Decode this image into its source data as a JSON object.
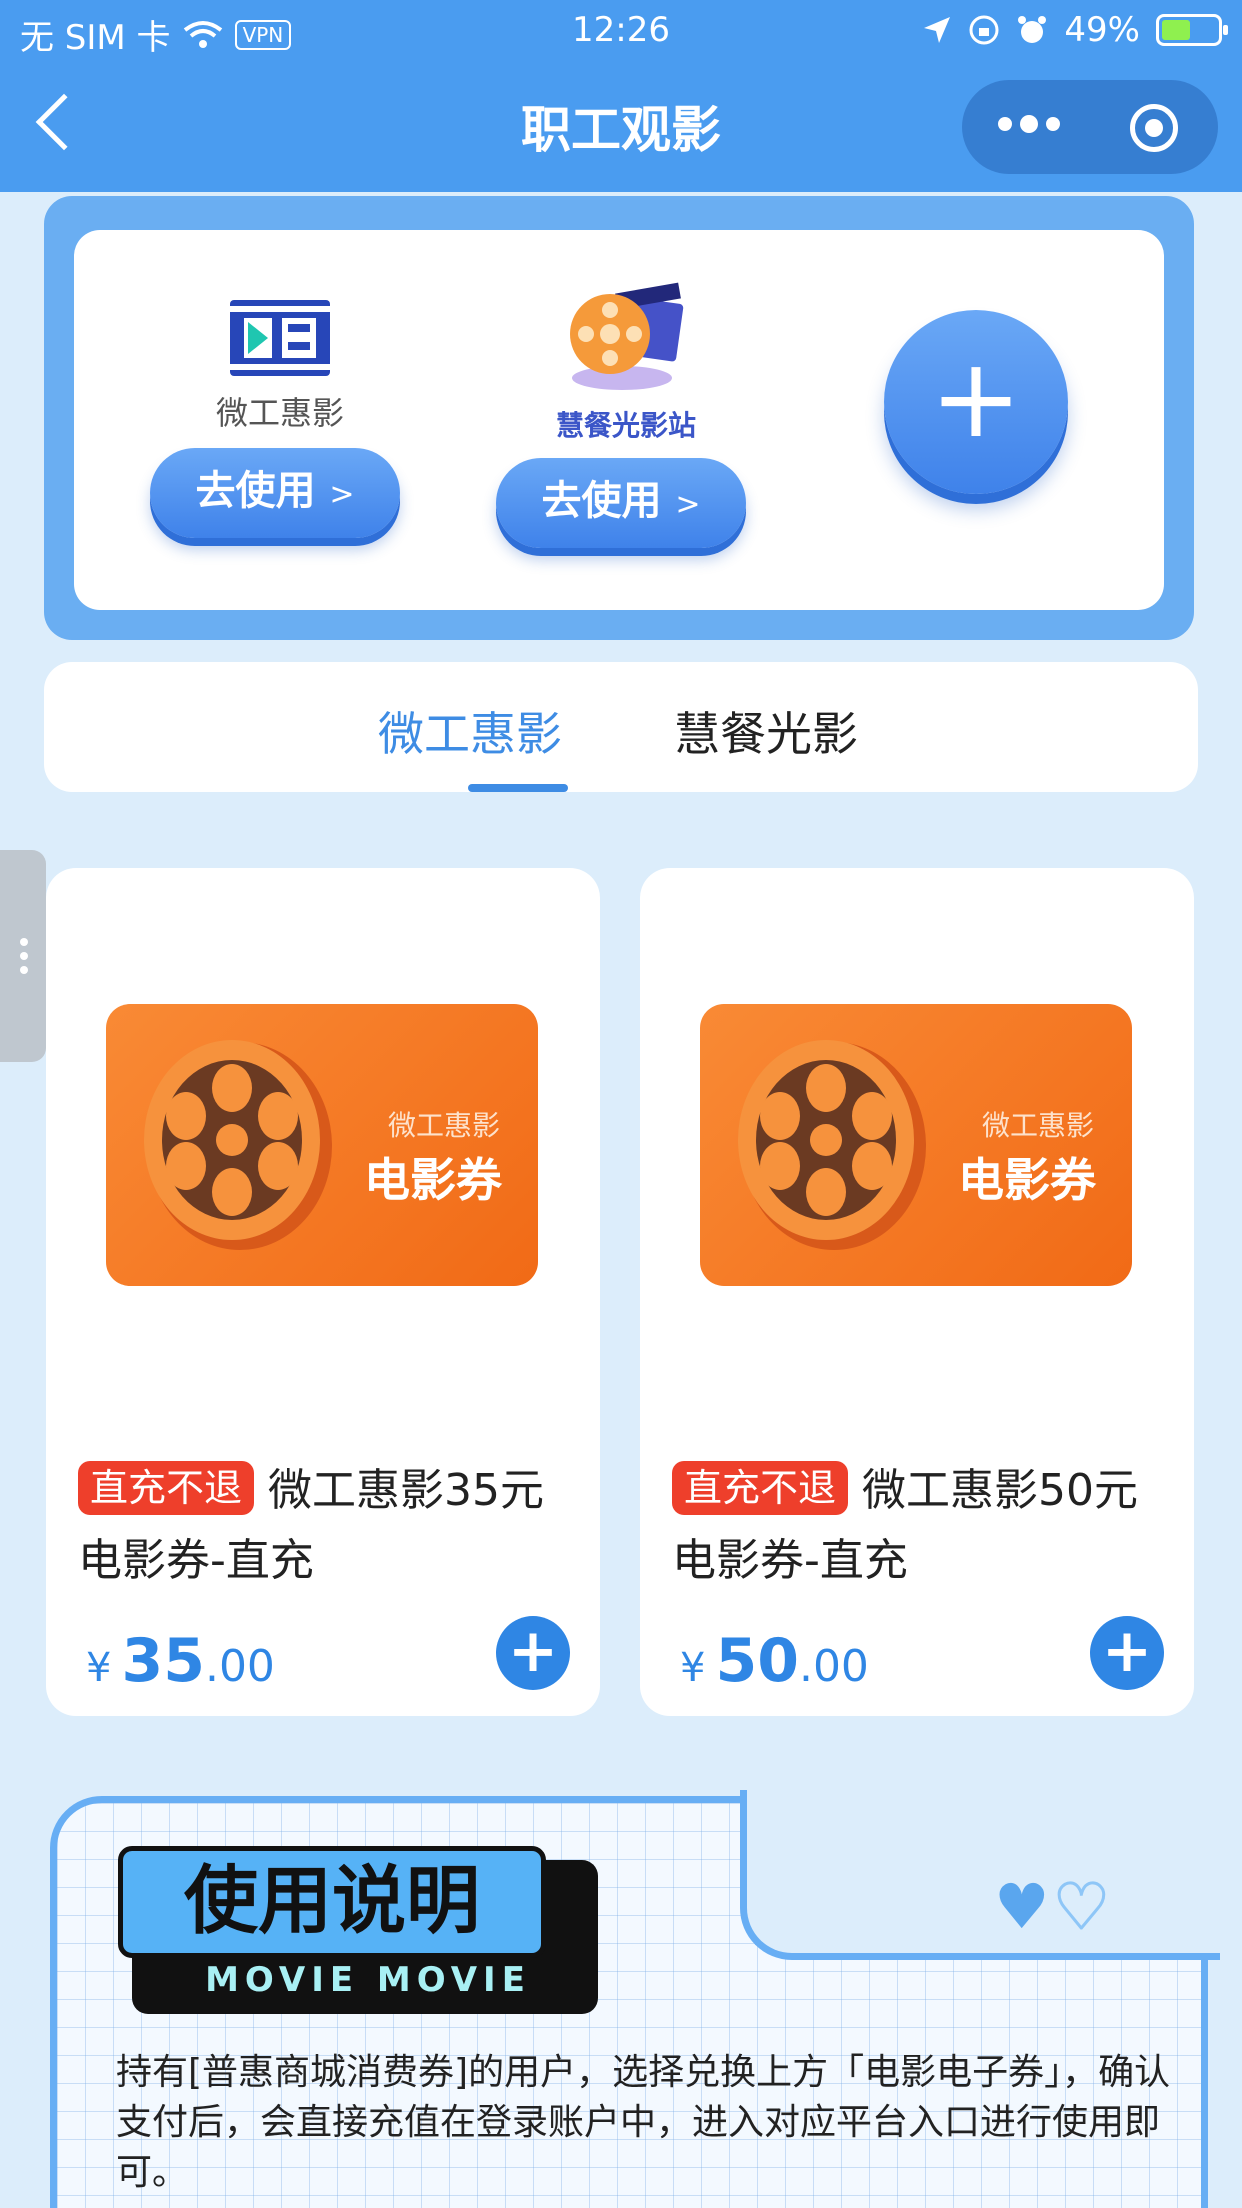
{
  "status_bar": {
    "carrier": "无 SIM 卡",
    "vpn": "VPN",
    "time": "12:26",
    "battery": "49%"
  },
  "nav": {
    "title": "职工观影"
  },
  "platforms": [
    {
      "name": "微工惠影",
      "button": "去使用",
      "arrow": ">"
    },
    {
      "name": "慧餐光影站",
      "button": "去使用",
      "arrow": ">"
    }
  ],
  "add_platform": "+",
  "tabs": [
    {
      "label": "微工惠影",
      "active": true
    },
    {
      "label": "慧餐光影",
      "active": false
    }
  ],
  "products": [
    {
      "image_sub": "微工惠影",
      "image_main": "电影券",
      "tag": "直充不退",
      "title": "微工惠影35元电影券-直充",
      "currency": "¥",
      "price_int": "35",
      "price_dec": ".00"
    },
    {
      "image_sub": "微工惠影",
      "image_main": "电影券",
      "tag": "直充不退",
      "title": "微工惠影50元电影券-直充",
      "currency": "¥",
      "price_int": "50",
      "price_dec": ".00"
    }
  ],
  "instructions": {
    "heading": "使用说明",
    "heading_en": "MOVIE MOVIE",
    "text": "持有[普惠商城消费券]的用户，选择兑换上方「电影电子券」，确认支付后，会直接充值在登录账户中，进入对应平台入口进行使用即可。"
  },
  "colors": {
    "header": "#4a9cf0",
    "accent": "#2f86e4",
    "tag": "#ee3f2b",
    "card_orange": "#f47a25"
  }
}
